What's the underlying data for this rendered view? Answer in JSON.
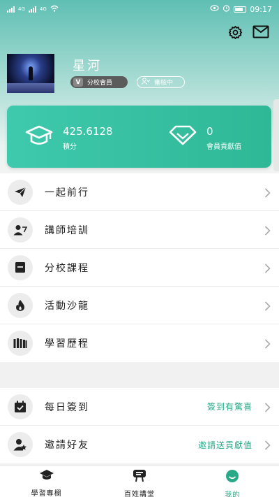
{
  "status_bar": {
    "left_text_1": "4G",
    "left_text_2": "4G",
    "time": "09:17",
    "battery_percent": 65
  },
  "profile": {
    "username": "星河",
    "member_badge": "分校會員",
    "member_badge_prefix": "V",
    "review_badge": "審核中"
  },
  "stats": {
    "points_value": "425.6128",
    "points_label": "積分",
    "contribution_value": "0",
    "contribution_label": "會員貢獻值"
  },
  "menu": [
    {
      "label": "一起前行",
      "icon": "paper-plane-icon"
    },
    {
      "label": "講師培訓",
      "icon": "lecturer-icon"
    },
    {
      "label": "分校課程",
      "icon": "course-icon"
    },
    {
      "label": "活動沙龍",
      "icon": "fire-icon"
    },
    {
      "label": "學習歷程",
      "icon": "history-icon"
    }
  ],
  "menu2": [
    {
      "label": "每日簽到",
      "extra": "簽到有驚喜",
      "icon": "calendar-check-icon"
    },
    {
      "label": "邀請好友",
      "extra": "邀請送貢獻值",
      "icon": "invite-user-icon"
    }
  ],
  "tabs": [
    {
      "label": "學習專欄",
      "icon": "graduation-cap-icon",
      "active": false
    },
    {
      "label": "百姓講堂",
      "icon": "lecture-podium-icon",
      "active": false
    },
    {
      "label": "我的",
      "icon": "smile-icon",
      "active": true
    }
  ],
  "colors": {
    "accent": "#2aa988",
    "card_start": "#3fc9ad",
    "card_end": "#2fb896"
  }
}
